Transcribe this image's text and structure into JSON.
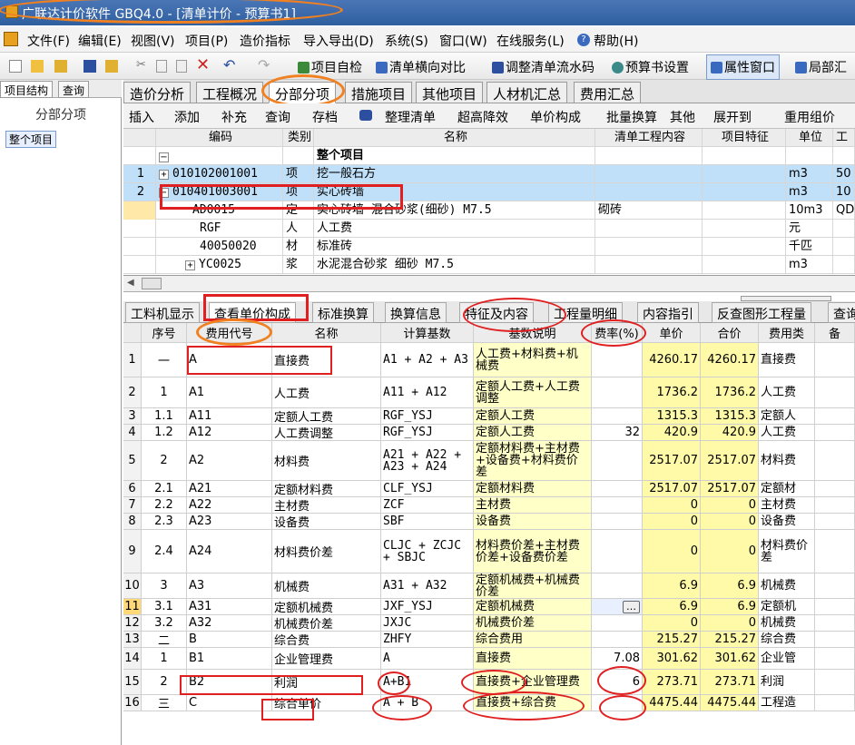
{
  "window": {
    "title": "广联达计价软件 GBQ4.0 - [清单计价 - 预算书1]"
  },
  "menu": [
    "文件(F)",
    "编辑(E)",
    "视图(V)",
    "项目(P)",
    "造价指标",
    "导入导出(D)",
    "系统(S)",
    "窗口(W)",
    "在线服务(L)",
    "帮助(H)"
  ],
  "toolbar": {
    "item1": "项目自检",
    "item2": "清单横向对比",
    "item3": "调整清单流水码",
    "item4": "预算书设置",
    "item5": "属性窗口",
    "item6": "局部汇"
  },
  "left": {
    "tab1": "项目结构",
    "tab2": "查询",
    "title": "分部分项",
    "item": "整个项目"
  },
  "main_tabs": [
    "造价分析",
    "工程概况",
    "分部分项",
    "措施项目",
    "其他项目",
    "人材机汇总",
    "费用汇总"
  ],
  "sub_toolbar": [
    "插入",
    "添加",
    "补充",
    "查询",
    "存档",
    "整理清单",
    "超高降效",
    "单价构成",
    "批量换算",
    "其他",
    "展开到",
    "重用组价"
  ],
  "grid1": {
    "headers": [
      "编码",
      "类别",
      "名称",
      "清单工程内容",
      "项目特征",
      "单位",
      "工"
    ],
    "rows": [
      {
        "idx": "",
        "code": "",
        "type": "",
        "name": "整个项目",
        "content": "",
        "unit": "",
        "extra": ""
      },
      {
        "idx": "1",
        "code": "010102001001",
        "type": "项",
        "name": "挖一般石方",
        "content": "",
        "unit": "m3",
        "extra": "50"
      },
      {
        "idx": "2",
        "code": "010401003001",
        "type": "项",
        "name": "实心砖墙",
        "content": "",
        "unit": "m3",
        "extra": "10"
      },
      {
        "idx": "",
        "code": "AD0015",
        "type": "定",
        "name": "实心砖墙 混合砂浆(细砂) M7.5",
        "content": "砌砖",
        "unit": "10m3",
        "extra": "QD"
      },
      {
        "idx": "",
        "code": "RGF",
        "type": "人",
        "name": "人工费",
        "content": "",
        "unit": "元",
        "extra": ""
      },
      {
        "idx": "",
        "code": "40050020",
        "type": "材",
        "name": "标准砖",
        "content": "",
        "unit": "千匹",
        "extra": ""
      },
      {
        "idx": "",
        "code": "YC0025",
        "type": "浆",
        "name": "水泥混合砂浆 细砂 M7.5",
        "content": "",
        "unit": "m3",
        "extra": ""
      }
    ]
  },
  "bottom_tabs": [
    "工料机显示",
    "查看单价构成",
    "标准换算",
    "换算信息",
    "特征及内容",
    "工程量明细",
    "内容指引",
    "反查图形工程量",
    "查询"
  ],
  "grid2": {
    "headers": [
      "序号",
      "费用代号",
      "名称",
      "计算基数",
      "基数说明",
      "费率(%)",
      "单价",
      "合价",
      "费用类",
      "备"
    ],
    "rows": [
      {
        "n": "1",
        "seq": "一",
        "code": "A",
        "name": "直接费",
        "base": "A1 + A2 + A3",
        "desc": "人工费+材料费+机械费",
        "rate": "",
        "price": "4260.17",
        "total": "4260.17",
        "cat": "直接费"
      },
      {
        "n": "2",
        "seq": "1",
        "code": "A1",
        "name": "人工费",
        "base": "A11 + A12",
        "desc": "定额人工费+人工费调整",
        "rate": "",
        "price": "1736.2",
        "total": "1736.2",
        "cat": "人工费"
      },
      {
        "n": "3",
        "seq": "1.1",
        "code": "A11",
        "name": "定额人工费",
        "base": "RGF_YSJ",
        "desc": "定额人工费",
        "rate": "",
        "price": "1315.3",
        "total": "1315.3",
        "cat": "定额人"
      },
      {
        "n": "4",
        "seq": "1.2",
        "code": "A12",
        "name": "人工费调整",
        "base": "RGF_YSJ",
        "desc": "定额人工费",
        "rate": "32",
        "price": "420.9",
        "total": "420.9",
        "cat": "人工费"
      },
      {
        "n": "5",
        "seq": "2",
        "code": "A2",
        "name": "材料费",
        "base": "A21 + A22 + A23 + A24",
        "desc": "定额材料费+主材费+设备费+材料费价差",
        "rate": "",
        "price": "2517.07",
        "total": "2517.07",
        "cat": "材料费"
      },
      {
        "n": "6",
        "seq": "2.1",
        "code": "A21",
        "name": "定额材料费",
        "base": "CLF_YSJ",
        "desc": "定额材料费",
        "rate": "",
        "price": "2517.07",
        "total": "2517.07",
        "cat": "定额材"
      },
      {
        "n": "7",
        "seq": "2.2",
        "code": "A22",
        "name": "主材费",
        "base": "ZCF",
        "desc": "主材费",
        "rate": "",
        "price": "0",
        "total": "0",
        "cat": "主材费"
      },
      {
        "n": "8",
        "seq": "2.3",
        "code": "A23",
        "name": "设备费",
        "base": "SBF",
        "desc": "设备费",
        "rate": "",
        "price": "0",
        "total": "0",
        "cat": "设备费"
      },
      {
        "n": "9",
        "seq": "2.4",
        "code": "A24",
        "name": "材料费价差",
        "base": "CLJC + ZCJC + SBJC",
        "desc": "材料费价差+主材费价差+设备费价差",
        "rate": "",
        "price": "0",
        "total": "0",
        "cat": "材料费价差"
      },
      {
        "n": "10",
        "seq": "3",
        "code": "A3",
        "name": "机械费",
        "base": "A31 + A32",
        "desc": "定额机械费+机械费价差",
        "rate": "",
        "price": "6.9",
        "total": "6.9",
        "cat": "机械费"
      },
      {
        "n": "11",
        "seq": "3.1",
        "code": "A31",
        "name": "定额机械费",
        "base": "JXF_YSJ",
        "desc": "定额机械费",
        "rate": "…",
        "price": "6.9",
        "total": "6.9",
        "cat": "定额机"
      },
      {
        "n": "12",
        "seq": "3.2",
        "code": "A32",
        "name": "机械费价差",
        "base": "JXJC",
        "desc": "机械费价差",
        "rate": "",
        "price": "0",
        "total": "0",
        "cat": "机械费"
      },
      {
        "n": "13",
        "seq": "二",
        "code": "B",
        "name": "综合费",
        "base": "ZHFY",
        "desc": "综合费用",
        "rate": "",
        "price": "215.27",
        "total": "215.27",
        "cat": "综合费"
      },
      {
        "n": "14",
        "seq": "1",
        "code": "B1",
        "name": "企业管理费",
        "base": "A",
        "desc": "直接费",
        "rate": "7.08",
        "price": "301.62",
        "total": "301.62",
        "cat": "企业管"
      },
      {
        "n": "15",
        "seq": "2",
        "code": "B2",
        "name": "利润",
        "base": "A+B1",
        "desc": "直接费+企业管理费",
        "rate": "6",
        "price": "273.71",
        "total": "273.71",
        "cat": "利润"
      },
      {
        "n": "16",
        "seq": "三",
        "code": "C",
        "name": "综合单价",
        "base": "A + B",
        "desc": "直接费+综合费",
        "rate": "",
        "price": "4475.44",
        "total": "4475.44",
        "cat": "工程造"
      }
    ]
  }
}
